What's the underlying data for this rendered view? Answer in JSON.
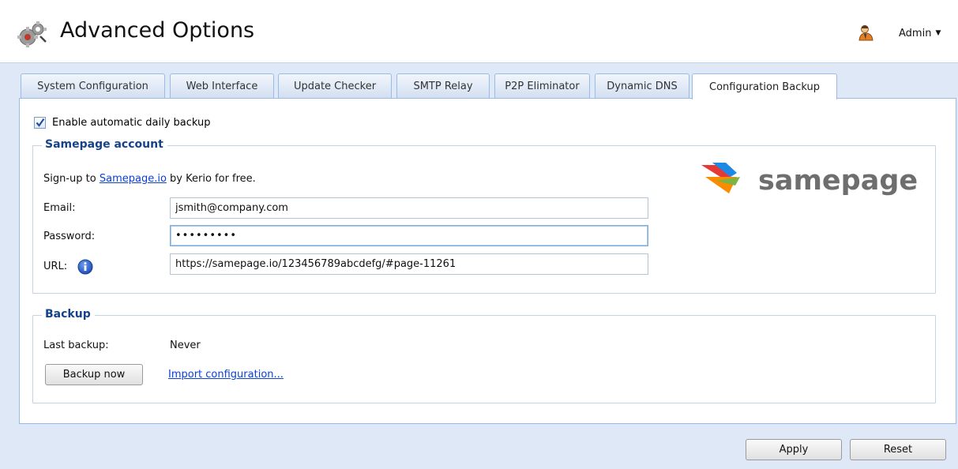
{
  "header": {
    "title": "Advanced Options",
    "icon": "gears-icon",
    "user_icon": "user-icon",
    "user_label": "Admin",
    "user_caret": "▼"
  },
  "tabs": [
    {
      "label": "System Configuration",
      "active": false
    },
    {
      "label": "Web Interface",
      "active": false
    },
    {
      "label": "Update Checker",
      "active": false
    },
    {
      "label": "SMTP Relay",
      "active": false
    },
    {
      "label": "P2P Eliminator",
      "active": false
    },
    {
      "label": "Dynamic DNS",
      "active": false
    },
    {
      "label": "Configuration Backup",
      "active": true
    }
  ],
  "auto_backup": {
    "checked": true,
    "label": "Enable automatic daily backup"
  },
  "samepage": {
    "legend": "Samepage account",
    "signup_prefix": "Sign-up to ",
    "signup_link": "Samepage.io",
    "signup_suffix": " by Kerio for free.",
    "email_label": "Email:",
    "email_value": "jsmith@company.com",
    "password_label": "Password:",
    "password_value": "secretpwd",
    "url_label": "URL:",
    "url_value": "https://samepage.io/123456789abcdefg/#page-11261",
    "logo_text": "samepage"
  },
  "backup": {
    "legend": "Backup",
    "last_backup_label": "Last backup:",
    "last_backup_value": "Never",
    "backup_now_label": "Backup now",
    "import_link": "Import configuration..."
  },
  "footer": {
    "apply_label": "Apply",
    "reset_label": "Reset"
  },
  "colors": {
    "accent": "#15428b",
    "link": "#0b3fd6",
    "background": "#dfe8f6",
    "border": "#99bbe8"
  }
}
